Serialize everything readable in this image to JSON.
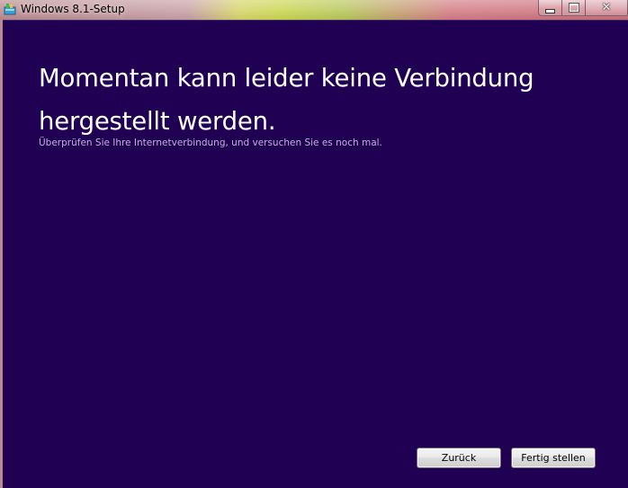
{
  "window": {
    "title": "Windows 8.1-Setup",
    "icon": "setup-app-icon"
  },
  "caption": {
    "minimize_icon": "minimize-icon",
    "maximize_icon": "maximize-icon",
    "close_icon": "close-icon",
    "close_glyph": "✕"
  },
  "main": {
    "heading": "Momentan kann leider keine Verbindung hergestellt werden.",
    "message": "Überprüfen Sie Ihre Internetverbindung, und versuchen Sie es noch mal."
  },
  "buttons": {
    "back_label": "Zurück",
    "finish_label": "Fertig stellen"
  },
  "colors": {
    "background": "#1f0053",
    "heading_text": "#ffffff",
    "message_text": "#c0b2da"
  }
}
